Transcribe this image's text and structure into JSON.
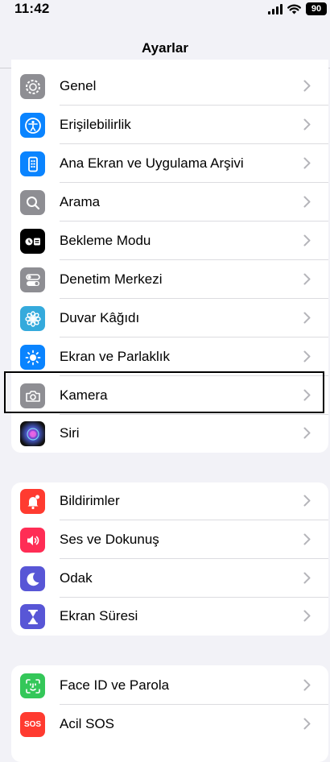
{
  "status_bar": {
    "time": "11:42",
    "battery": "90"
  },
  "header": {
    "title": "Ayarlar"
  },
  "groups": [
    {
      "items": [
        {
          "label": "Genel",
          "icon": "gear-icon",
          "color": "#8e8e93"
        },
        {
          "label": "Erişilebilirlik",
          "icon": "accessibility-icon",
          "color": "#0a84ff"
        },
        {
          "label": "Ana Ekran ve Uygulama Arşivi",
          "icon": "home-screen-icon",
          "color": "#0a84ff"
        },
        {
          "label": "Arama",
          "icon": "search-icon",
          "color": "#8e8e93"
        },
        {
          "label": "Bekleme Modu",
          "icon": "standby-icon",
          "color": "#000000"
        },
        {
          "label": "Denetim Merkezi",
          "icon": "control-center-icon",
          "color": "#8e8e93"
        },
        {
          "label": "Duvar Kâğıdı",
          "icon": "wallpaper-flower-icon",
          "color": "#35aadc"
        },
        {
          "label": "Ekran ve Parlaklık",
          "icon": "brightness-icon",
          "color": "#0a84ff"
        },
        {
          "label": "Kamera",
          "icon": "camera-icon",
          "color": "#8e8e93"
        },
        {
          "label": "Siri",
          "icon": "siri-icon",
          "color": "#1c1c1e"
        }
      ]
    },
    {
      "items": [
        {
          "label": "Bildirimler",
          "icon": "bell-icon",
          "color": "#ff3b30"
        },
        {
          "label": "Ses ve Dokunuş",
          "icon": "speaker-icon",
          "color": "#ff2d55"
        },
        {
          "label": "Odak",
          "icon": "moon-icon",
          "color": "#5856d6"
        },
        {
          "label": "Ekran Süresi",
          "icon": "hourglass-icon",
          "color": "#5856d6"
        }
      ]
    },
    {
      "items": [
        {
          "label": "Face ID ve Parola",
          "icon": "face-id-icon",
          "color": "#34c759"
        },
        {
          "label": "Acil SOS",
          "icon": "sos-icon",
          "color": "#ff3b30",
          "badge": "SOS"
        }
      ]
    }
  ]
}
